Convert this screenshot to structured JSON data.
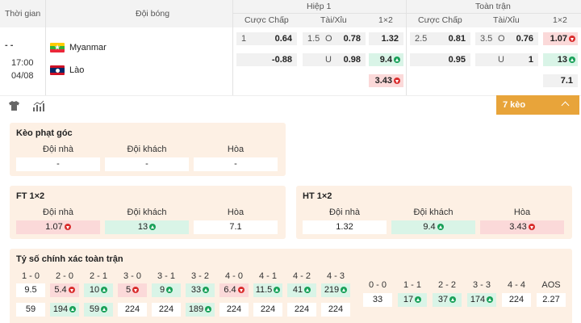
{
  "header": {
    "time_col": "Thời gian",
    "team_col": "Đội bóng",
    "half1": "Hiệp 1",
    "full": "Toàn trận",
    "h1_cols": [
      "Cược Chấp",
      "Tài/Xỉu",
      "1×2"
    ],
    "ft_cols": [
      "Cược Chấp",
      "Tài/Xỉu",
      "1×2"
    ]
  },
  "match": {
    "dash": "- -",
    "time": "17:00",
    "date": "04/08",
    "home": "Myanmar",
    "away": "Lào"
  },
  "odds": {
    "h1_handicap": {
      "line": "1",
      "home": "0.64",
      "away": "-0.88"
    },
    "h1_ou": {
      "line": "1.5",
      "o": "O",
      "o_val": "0.78",
      "u": "U",
      "u_val": "0.98"
    },
    "h1_1x2": {
      "home": "1.32",
      "away": "9.4",
      "draw": "3.43"
    },
    "ft_handicap": {
      "line": "2.5",
      "home": "0.81",
      "away": "0.95"
    },
    "ft_ou": {
      "line": "3.5",
      "o": "O",
      "o_val": "0.76",
      "u": "U",
      "u_val": "1"
    },
    "ft_1x2": {
      "home": "1.07",
      "away": "13",
      "draw": "7.1"
    }
  },
  "toolbar": {
    "keo_label": "7 kèo"
  },
  "corner": {
    "title": "Kèo phạt góc",
    "labels": [
      "Đội nhà",
      "Đội khách",
      "Hòa"
    ],
    "values": [
      "-",
      "-",
      "-"
    ]
  },
  "ft1x2": {
    "title": "FT 1×2",
    "labels": [
      "Đội nhà",
      "Đội khách",
      "Hòa"
    ],
    "values": [
      "1.07",
      "13",
      "7.1"
    ]
  },
  "ht1x2": {
    "title": "HT 1×2",
    "labels": [
      "Đội nhà",
      "Đội khách",
      "Hòa"
    ],
    "values": [
      "1.32",
      "9.4",
      "3.43"
    ]
  },
  "correct_score": {
    "title": "Tỷ số chính xác toàn trận",
    "left_labels": [
      "1 - 0",
      "2 - 0",
      "2 - 1",
      "3 - 0",
      "3 - 1",
      "3 - 2",
      "4 - 0",
      "4 - 1",
      "4 - 2",
      "4 - 3"
    ],
    "left_row1": [
      "9.5",
      "5.4",
      "10",
      "5",
      "9",
      "33",
      "6.4",
      "11.5",
      "41",
      "219"
    ],
    "left_row2": [
      "59",
      "194",
      "59",
      "224",
      "224",
      "189",
      "224",
      "224",
      "224",
      "224"
    ],
    "right_labels": [
      "0 - 0",
      "1 - 1",
      "2 - 2",
      "3 - 3",
      "4 - 4",
      "AOS"
    ],
    "right_values": [
      "33",
      "17",
      "37",
      "174",
      "224",
      "2.27"
    ]
  },
  "colors": {
    "accent": "#e8a43a",
    "panel": "#fdf0e4",
    "up": "#18a058",
    "down": "#d92d2d"
  }
}
